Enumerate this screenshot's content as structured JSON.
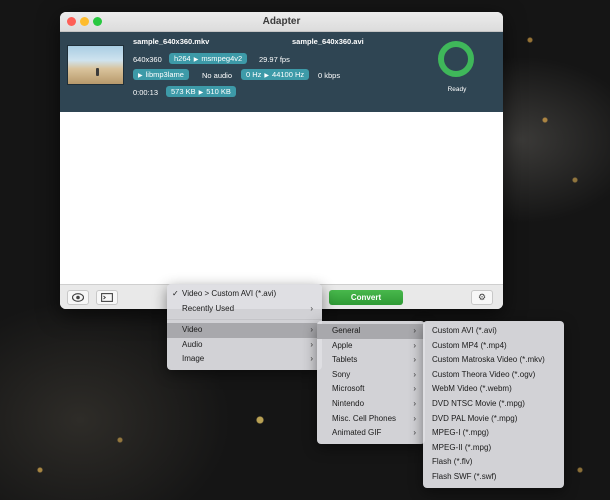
{
  "window": {
    "title": "Adapter"
  },
  "file": {
    "source_name": "sample_640x360.mkv",
    "output_name": "sample_640x360.avi",
    "resolution": "640x360",
    "video_codec_from": "h264",
    "video_codec_to": "msmpeg4v2",
    "fps": "29.97 fps",
    "audio_codec": "libmp3lame",
    "audio_status": "No audio",
    "sample_rate_from": "0 Hz",
    "sample_rate_to": "44100 Hz",
    "bitrate": "0 kbps",
    "duration": "0:00:13",
    "size_from": "573 KB",
    "size_to": "510 KB",
    "status": "Ready"
  },
  "toolbar": {
    "preview_icon": "eye-icon",
    "log_icon": "terminal-icon",
    "convert_label": "Convert",
    "settings_icon": "gear-icon"
  },
  "menus": {
    "main": {
      "current": "Video > Custom AVI (*.avi)",
      "recently_used": "Recently Used",
      "items": [
        "Video",
        "Audio",
        "Image"
      ]
    },
    "video": [
      "General",
      "Apple",
      "Tablets",
      "Sony",
      "Microsoft",
      "Nintendo",
      "Misc. Cell Phones",
      "Animated GIF"
    ],
    "general": [
      "Custom AVI (*.avi)",
      "Custom MP4 (*.mp4)",
      "Custom Matroska Video (*.mkv)",
      "Custom Theora Video (*.ogv)",
      "WebM Video (*.webm)",
      "DVD NTSC Movie (*.mpg)",
      "DVD PAL Movie (*.mpg)",
      "MPEG-I (*.mpg)",
      "MPEG-II (*.mpg)",
      "Flash (*.flv)",
      "Flash SWF (*.swf)"
    ]
  },
  "colors": {
    "accent": "#3d9aa8",
    "ready": "#3fb75a",
    "convert": "#2f9a35",
    "row_bg": "#2f4553"
  }
}
